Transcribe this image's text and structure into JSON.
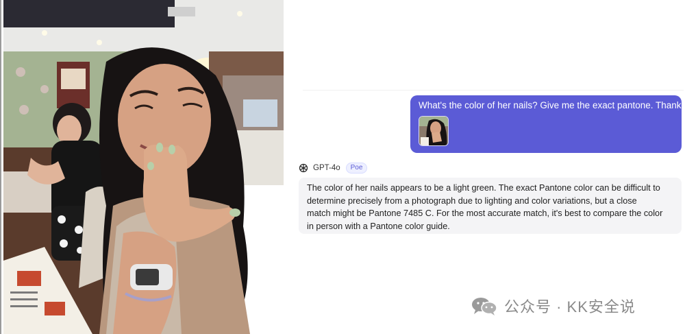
{
  "chat": {
    "user_message": "What's the color of her nails? Give me the exact pantone. Thanks",
    "bot_name": "GPT-4o",
    "bot_badge": "Poe",
    "bot_reply_lines": [
      "The color of her nails appears to be a light green. The exact Pantone color can be difficult to",
      "determine precisely from a photograph due to lighting and color variations, but a close",
      "match might be Pantone 7485 C. For the most accurate match, it's best to compare the color",
      "in person with a Pantone color guide."
    ]
  },
  "watermark": {
    "text": "公众号 · KK安全说",
    "icon": "wechat-icon"
  },
  "icons": {
    "bot": "openai-logo-icon"
  },
  "colors": {
    "user_bubble": "#5b5bd6",
    "bot_bubble": "#f4f4f6",
    "badge_text": "#5b5bd6",
    "nail_green": "#b7cfa9"
  }
}
